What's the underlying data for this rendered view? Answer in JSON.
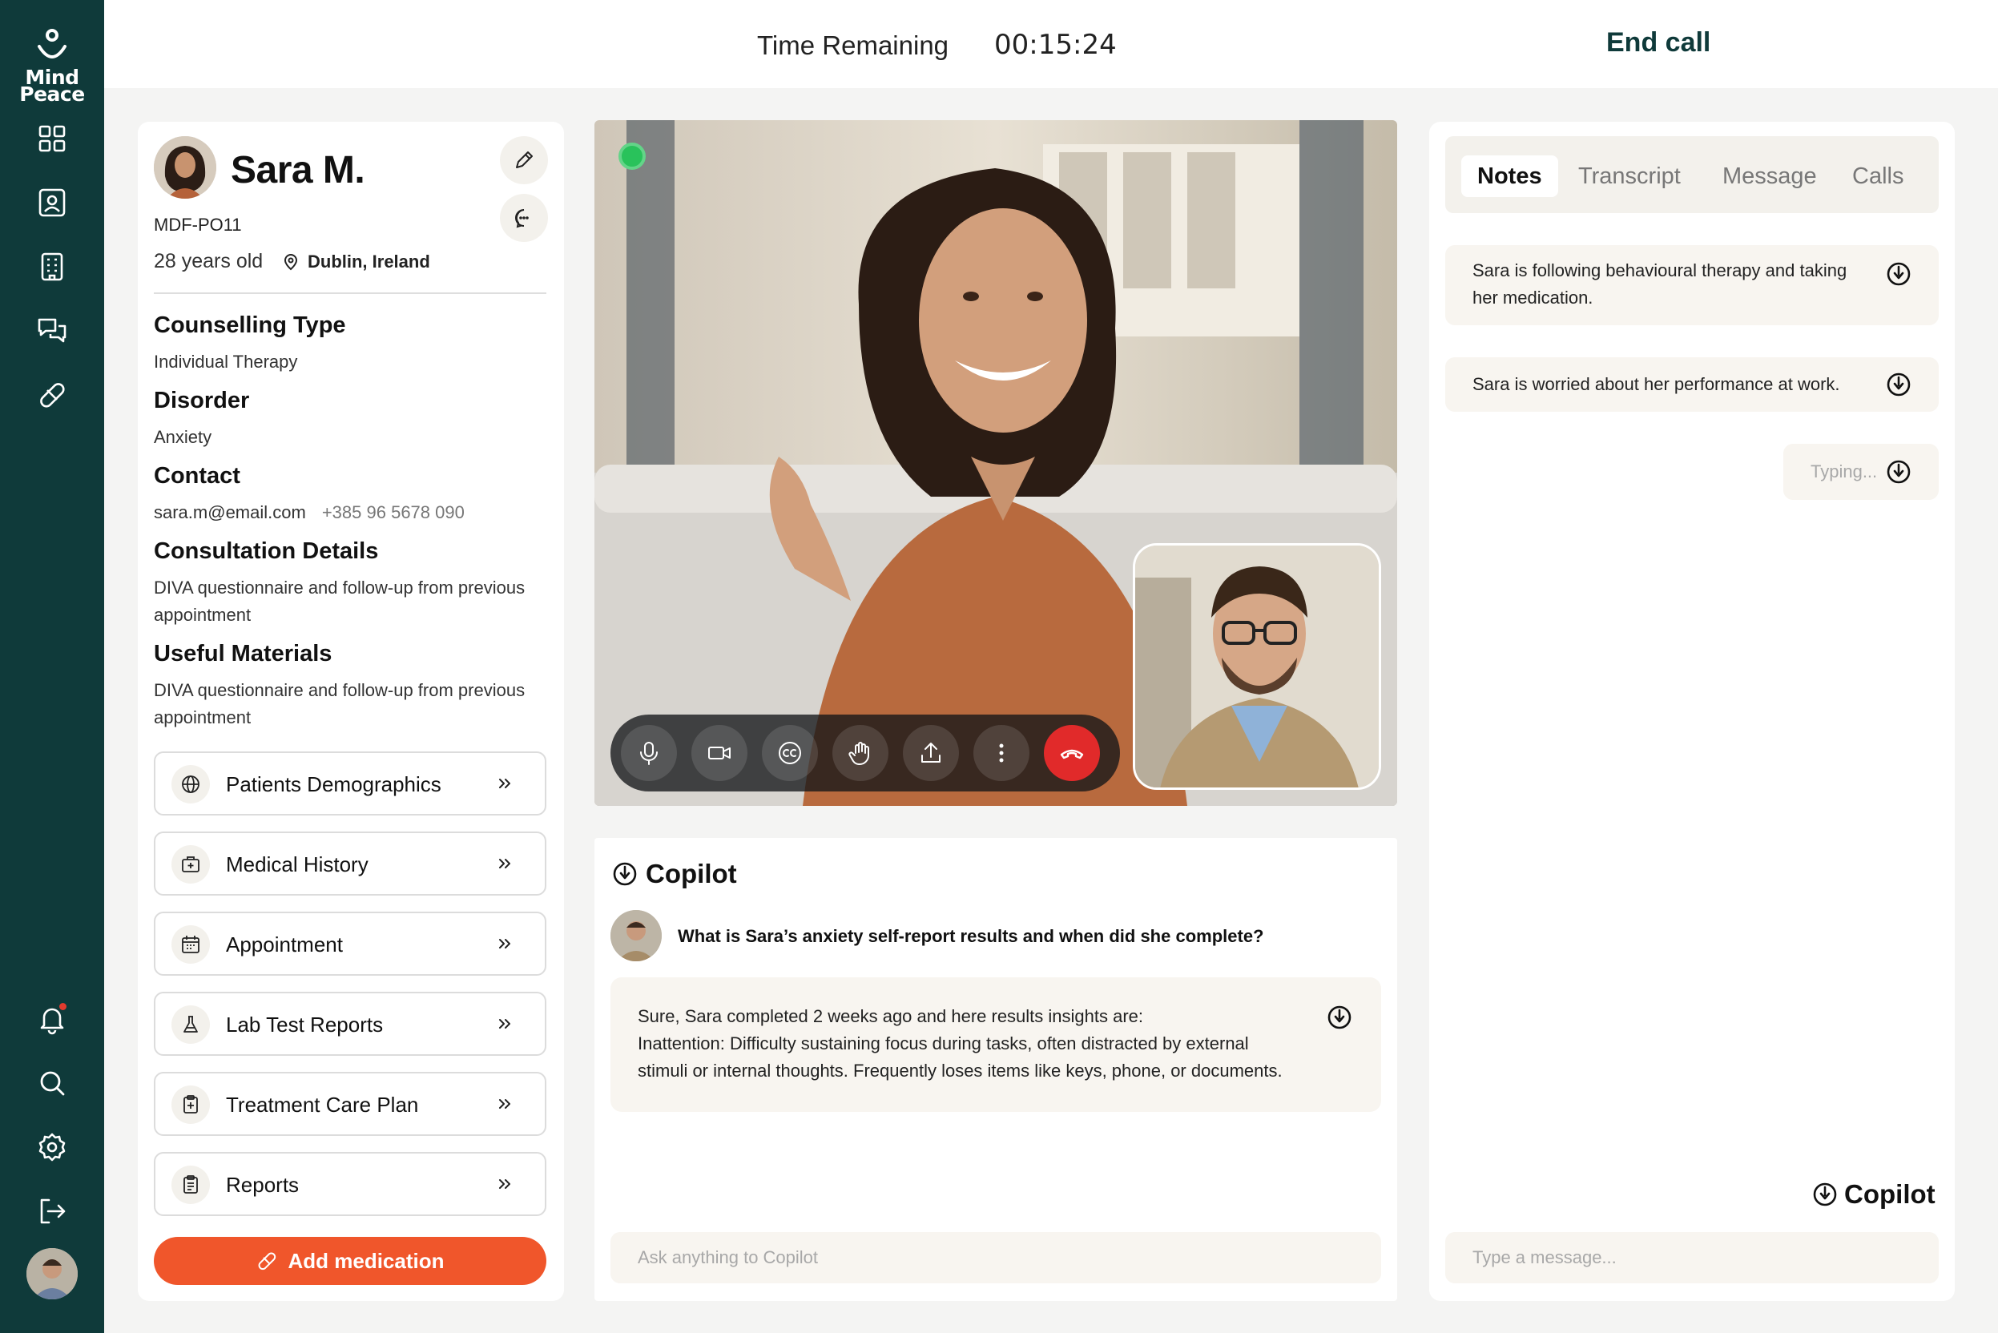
{
  "app": {
    "logo_line1": "Mind",
    "logo_line2": "Peace"
  },
  "topbar": {
    "time_label": "Time Remaining",
    "time_value": "00:15:24",
    "end_call_label": "End call"
  },
  "patient": {
    "name": "Sara M.",
    "id": "MDF-PO11",
    "age": "28 years old",
    "location": "Dublin, Ireland"
  },
  "sections": {
    "counselling_heading": "Counselling Type",
    "counselling_value": "Individual Therapy",
    "disorder_heading": "Disorder",
    "disorder_value": "Anxiety",
    "contact_heading": "Contact",
    "contact_email": "sara.m@email.com",
    "contact_phone": "+385 96 5678 090",
    "consultation_heading": "Consultation Details",
    "consultation_value": "DIVA questionnaire and follow-up from previous appointment",
    "materials_heading": "Useful Materials",
    "materials_value": "DIVA questionnaire and follow-up from previous appointment"
  },
  "links": [
    {
      "label": "Patients Demographics",
      "icon": "globe-icon"
    },
    {
      "label": "Medical History",
      "icon": "briefcase-medical-icon"
    },
    {
      "label": "Appointment",
      "icon": "calendar-icon"
    },
    {
      "label": "Lab Test Reports",
      "icon": "flask-icon"
    },
    {
      "label": "Treatment Care Plan",
      "icon": "clipboard-plus-icon"
    },
    {
      "label": "Reports",
      "icon": "clipboard-list-icon"
    }
  ],
  "add_medication_label": "Add medication",
  "copilot": {
    "title": "Copilot",
    "question": "What is Sara’s anxiety self-report results and when did she complete?",
    "answer_line1": "Sure, Sara completed 2 weeks ago and here results insights are:",
    "answer_line2": "Inattention: Difficulty sustaining focus during tasks, often distracted by external stimuli or internal thoughts. Frequently loses items like keys, phone, or documents.",
    "ask_placeholder": "Ask anything to Copilot"
  },
  "right_panel": {
    "tabs": [
      "Notes",
      "Transcript",
      "Message",
      "Calls"
    ],
    "active_tab": "Notes",
    "notes": [
      "Sara is following behavioural therapy and taking her medication.",
      "Sara is worried about her performance at work."
    ],
    "typing_label": "Typing...",
    "copilot_label": "Copilot",
    "message_placeholder": "Type a message..."
  },
  "colors": {
    "sidebar": "#0f3a3a",
    "accent": "#f0562b",
    "end_call": "#e12a2a",
    "live": "#29c25b",
    "soft_bg": "#f8f5f0"
  }
}
